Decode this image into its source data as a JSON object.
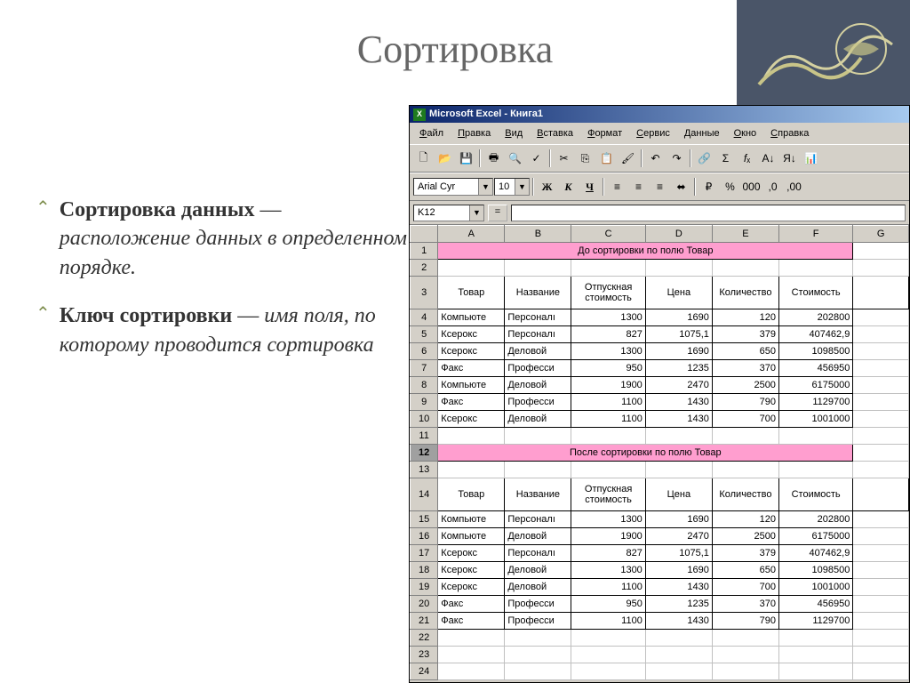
{
  "slide": {
    "title": "Сортировка",
    "bullets": [
      {
        "bold": "Сортировка данных",
        "rest": " — ",
        "em": "расположение данных в определенном порядке."
      },
      {
        "bold": "Ключ сортировки",
        "rest": " — ",
        "em": "имя поля, по которому проводится сортировка"
      }
    ]
  },
  "excel": {
    "title": "Microsoft Excel - Книга1",
    "menu": [
      "Файл",
      "Правка",
      "Вид",
      "Вставка",
      "Формат",
      "Сервис",
      "Данные",
      "Окно",
      "Справка"
    ],
    "font": "Arial Cyr",
    "fontsize": "10",
    "active_cell": "K12",
    "columns": [
      "A",
      "B",
      "C",
      "D",
      "E",
      "F",
      "G"
    ],
    "banner1": "До сортировки по полю Товар",
    "banner2": "После сортировки по полю Товар",
    "headers": [
      "Товар",
      "Название",
      "Отпускная стоимость",
      "Цена",
      "Количество",
      "Стоимость"
    ],
    "before_rows": [
      [
        "Компьюте",
        "Персоналı",
        "1300",
        "1690",
        "120",
        "202800"
      ],
      [
        "Ксерокс",
        "Персоналı",
        "827",
        "1075,1",
        "379",
        "407462,9"
      ],
      [
        "Ксерокс",
        "Деловой",
        "1300",
        "1690",
        "650",
        "1098500"
      ],
      [
        "Факс",
        "Професси",
        "950",
        "1235",
        "370",
        "456950"
      ],
      [
        "Компьюте",
        "Деловой",
        "1900",
        "2470",
        "2500",
        "6175000"
      ],
      [
        "Факс",
        "Професси",
        "1100",
        "1430",
        "790",
        "1129700"
      ],
      [
        "Ксерокс",
        "Деловой",
        "1100",
        "1430",
        "700",
        "1001000"
      ]
    ],
    "after_rows": [
      [
        "Компьюте",
        "Персоналı",
        "1300",
        "1690",
        "120",
        "202800"
      ],
      [
        "Компьюте",
        "Деловой",
        "1900",
        "2470",
        "2500",
        "6175000"
      ],
      [
        "Ксерокс",
        "Персоналı",
        "827",
        "1075,1",
        "379",
        "407462,9"
      ],
      [
        "Ксерокс",
        "Деловой",
        "1300",
        "1690",
        "650",
        "1098500"
      ],
      [
        "Ксерокс",
        "Деловой",
        "1100",
        "1430",
        "700",
        "1001000"
      ],
      [
        "Факс",
        "Професси",
        "950",
        "1235",
        "370",
        "456950"
      ],
      [
        "Факс",
        "Професси",
        "1100",
        "1430",
        "790",
        "1129700"
      ]
    ]
  },
  "chart_data": {
    "type": "table",
    "title_before": "До сортировки по полю Товар",
    "title_after": "После сортировки по полю Товар",
    "columns": [
      "Товар",
      "Название",
      "Отпускная стоимость",
      "Цена",
      "Количество",
      "Стоимость"
    ],
    "before": [
      {
        "Товар": "Компьютер",
        "Название": "Персональный",
        "Отпускная стоимость": 1300,
        "Цена": 1690,
        "Количество": 120,
        "Стоимость": 202800
      },
      {
        "Товар": "Ксерокс",
        "Название": "Персональный",
        "Отпускная стоимость": 827,
        "Цена": 1075.1,
        "Количество": 379,
        "Стоимость": 407462.9
      },
      {
        "Товар": "Ксерокс",
        "Название": "Деловой",
        "Отпускная стоимость": 1300,
        "Цена": 1690,
        "Количество": 650,
        "Стоимость": 1098500
      },
      {
        "Товар": "Факс",
        "Название": "Профессиональный",
        "Отпускная стоимость": 950,
        "Цена": 1235,
        "Количество": 370,
        "Стоимость": 456950
      },
      {
        "Товар": "Компьютер",
        "Название": "Деловой",
        "Отпускная стоимость": 1900,
        "Цена": 2470,
        "Количество": 2500,
        "Стоимость": 6175000
      },
      {
        "Товар": "Факс",
        "Название": "Профессиональный",
        "Отпускная стоимость": 1100,
        "Цена": 1430,
        "Количество": 790,
        "Стоимость": 1129700
      },
      {
        "Товар": "Ксерокс",
        "Название": "Деловой",
        "Отпускная стоимость": 1100,
        "Цена": 1430,
        "Количество": 700,
        "Стоимость": 1001000
      }
    ],
    "after": [
      {
        "Товар": "Компьютер",
        "Название": "Персональный",
        "Отпускная стоимость": 1300,
        "Цена": 1690,
        "Количество": 120,
        "Стоимость": 202800
      },
      {
        "Товар": "Компьютер",
        "Название": "Деловой",
        "Отпускная стоимость": 1900,
        "Цена": 2470,
        "Количество": 2500,
        "Стоимость": 6175000
      },
      {
        "Товар": "Ксерокс",
        "Название": "Персональный",
        "Отпускная стоимость": 827,
        "Цена": 1075.1,
        "Количество": 379,
        "Стоимость": 407462.9
      },
      {
        "Товар": "Ксерокс",
        "Название": "Деловой",
        "Отпускная стоимость": 1300,
        "Цена": 1690,
        "Количество": 650,
        "Стоимость": 1098500
      },
      {
        "Товар": "Ксерокс",
        "Название": "Деловой",
        "Отпускная стоимость": 1100,
        "Цена": 1430,
        "Количество": 700,
        "Стоимость": 1001000
      },
      {
        "Товар": "Факс",
        "Название": "Профессиональный",
        "Отпускная стоимость": 950,
        "Цена": 1235,
        "Количество": 370,
        "Стоимость": 456950
      },
      {
        "Товар": "Факс",
        "Название": "Профессиональный",
        "Отпускная стоимость": 1100,
        "Цена": 1430,
        "Количество": 790,
        "Стоимость": 1129700
      }
    ]
  }
}
